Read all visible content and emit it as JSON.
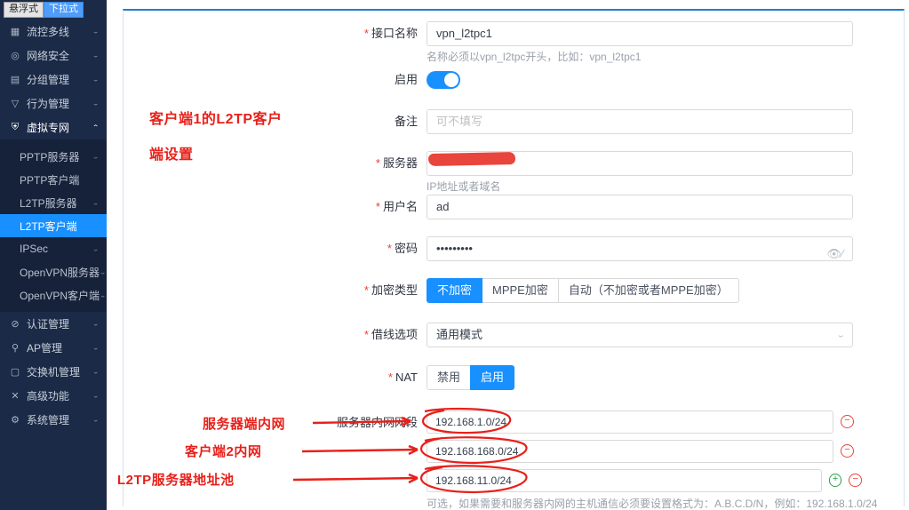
{
  "mode_toggle": {
    "options": [
      "悬浮式",
      "下拉式"
    ],
    "selected": "下拉式"
  },
  "sidebar": {
    "items": [
      {
        "icon": "grid-icon",
        "label": "流控多线",
        "caret": "chevron-down"
      },
      {
        "icon": "shield-icon",
        "label": "网络安全",
        "caret": "chevron-down"
      },
      {
        "icon": "group-icon",
        "label": "分组管理",
        "caret": "chevron-down"
      },
      {
        "icon": "filter-icon",
        "label": "行为管理",
        "caret": "chevron-down"
      },
      {
        "icon": "vpn-icon",
        "label": "虚拟专网",
        "caret": "chevron-up"
      }
    ],
    "sub_items": [
      {
        "label": "PPTP服务器",
        "caret": "chevron-down",
        "active": false
      },
      {
        "label": "PPTP客户端",
        "caret": "",
        "active": false
      },
      {
        "label": "L2TP服务器",
        "caret": "chevron-down",
        "active": false
      },
      {
        "label": "L2TP客户端",
        "caret": "",
        "active": true
      },
      {
        "label": "IPSec",
        "caret": "chevron-down",
        "active": false
      },
      {
        "label": "OpenVPN服务器",
        "caret": "chevron-down",
        "active": false
      },
      {
        "label": "OpenVPN客户端",
        "caret": "chevron-down",
        "active": false
      }
    ],
    "items_bottom": [
      {
        "icon": "check-circle-icon",
        "label": "认证管理",
        "caret": "chevron-down"
      },
      {
        "icon": "wifi-icon",
        "label": "AP管理",
        "caret": "chevron-down"
      },
      {
        "icon": "switch-icon",
        "label": "交换机管理",
        "caret": "chevron-down"
      },
      {
        "icon": "tools-icon",
        "label": "高级功能",
        "caret": "chevron-down"
      },
      {
        "icon": "gear-icon",
        "label": "系统管理",
        "caret": "chevron-down"
      }
    ]
  },
  "form": {
    "interface_name": {
      "label": "接口名称",
      "required": true,
      "value": "vpn_l2tpc1",
      "hint": "名称必须以vpn_l2tpc开头，比如：vpn_l2tpc1"
    },
    "enable": {
      "label": "启用",
      "required": false,
      "on": true
    },
    "remark": {
      "label": "备注",
      "required": false,
      "value": "",
      "placeholder": "可不填写"
    },
    "server": {
      "label": "服务器",
      "required": true,
      "value": "",
      "redacted": true,
      "hint": "IP地址或者域名"
    },
    "username": {
      "label": "用户名",
      "required": true,
      "value": "ad"
    },
    "password": {
      "label": "密码",
      "required": true,
      "value": "•••••••••",
      "eye_icon": "eye-off-icon"
    },
    "encryption": {
      "label": "加密类型",
      "required": true,
      "options": [
        "不加密",
        "MPPE加密",
        "自动（不加密或者MPPE加密）"
      ],
      "selected": "不加密"
    },
    "line_option": {
      "label": "借线选项",
      "required": true,
      "value": "通用模式",
      "chevron": "chevron-down-icon"
    },
    "nat": {
      "label": "NAT",
      "required": true,
      "options": [
        "禁用",
        "启用"
      ],
      "selected": "启用"
    },
    "server_subnet": {
      "label": "服务器内网网段",
      "required": false,
      "rows": [
        {
          "value": "192.168.1.0/24",
          "remove": true,
          "add": false
        },
        {
          "value": "192.168.168.0/24",
          "remove": true,
          "add": false
        },
        {
          "value": "192.168.11.0/24",
          "remove": true,
          "add": true
        }
      ],
      "hint": "可选，如果需要和服务器内网的主机通信必须要设置格式为：A.B.C.D/N，例如：192.168.1.0/24"
    }
  },
  "annotations": [
    {
      "name": "client1-l2tp-setting",
      "line1": "客户端1的L2TP客户",
      "line2": "端设置"
    },
    {
      "name": "server-lan",
      "text": "服务器端内网"
    },
    {
      "name": "client2-lan",
      "text": "客户端2内网"
    },
    {
      "name": "l2tp-server-pool",
      "text": "L2TP服务器地址池"
    }
  ]
}
